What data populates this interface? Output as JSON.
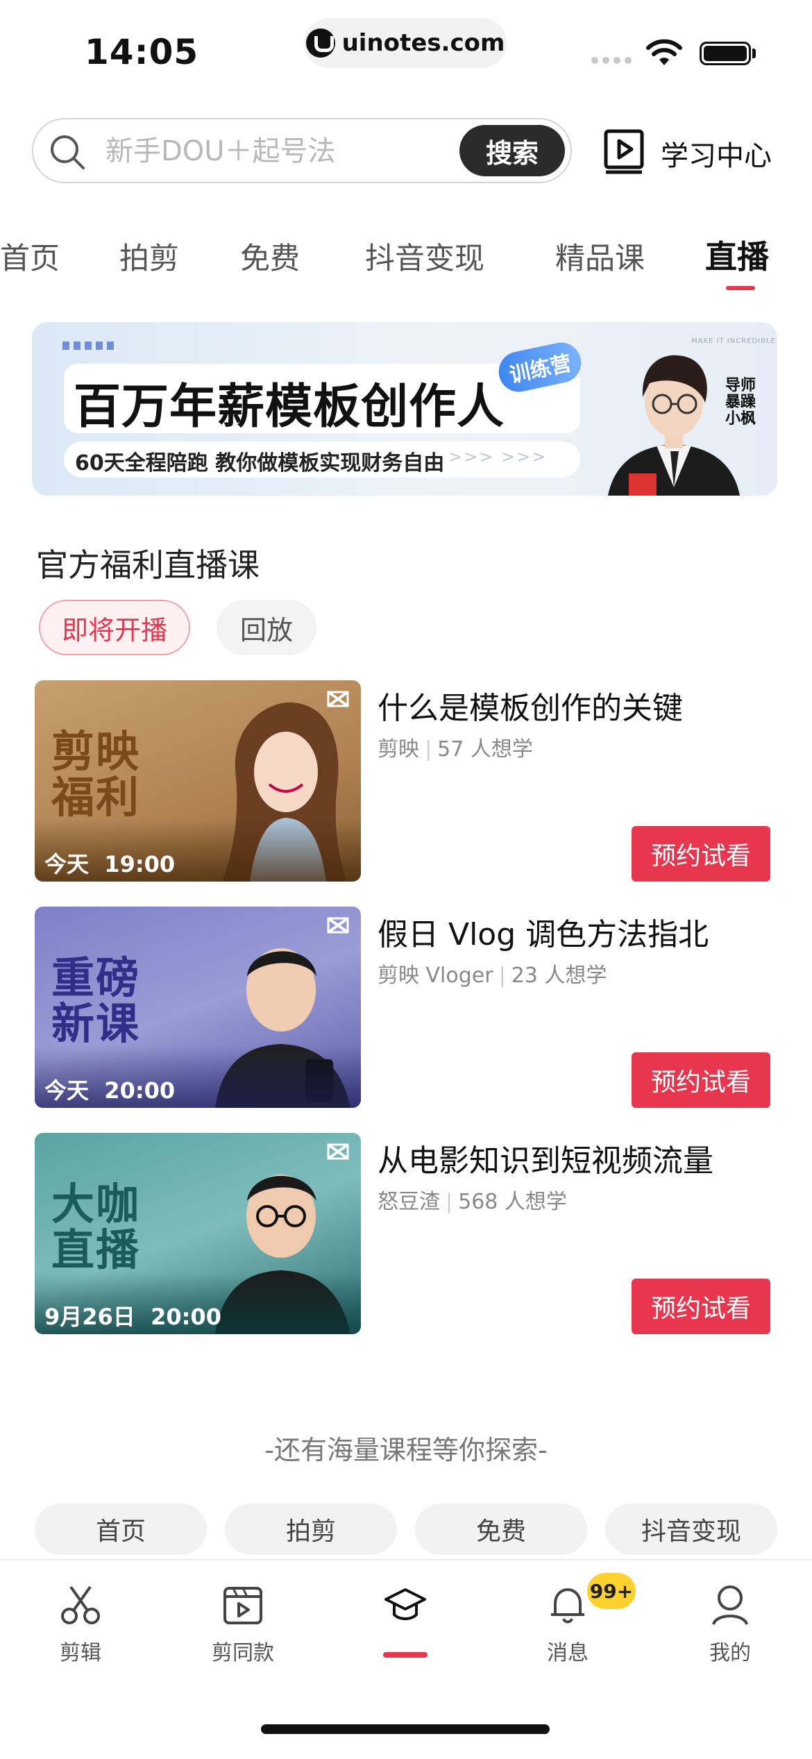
{
  "status_bar": {
    "time": "14:05",
    "url": "uinotes.com"
  },
  "search": {
    "placeholder": "新手DOU＋起号法",
    "button_label": "搜索"
  },
  "learning_center": {
    "label": "学习中心",
    "icon": "play-book-icon"
  },
  "category_tabs": [
    {
      "label": "首页",
      "active": false
    },
    {
      "label": "拍剪",
      "active": false
    },
    {
      "label": "免费",
      "active": false
    },
    {
      "label": "抖音变现",
      "active": false
    },
    {
      "label": "精品课",
      "active": false
    },
    {
      "label": "直播",
      "active": true
    }
  ],
  "banner": {
    "title": "百万年薪模板创作人",
    "subtitle": "60天全程陪跑 教你做模板实现财务自由",
    "arrows": ">>>    >>>",
    "badge": "训练营",
    "mentor": "导师暴躁小枫",
    "tiny_text": "MAKE IT INCREDIBLE"
  },
  "section": {
    "title": "官方福利直播课",
    "filters": [
      {
        "label": "即将开播",
        "active": true
      },
      {
        "label": "回放",
        "active": false
      }
    ]
  },
  "courses": [
    {
      "title": "什么是模板创作的关键",
      "author": "剪映",
      "interest": "57 人想学",
      "thumb_text": "剪映福利",
      "thumb_line1": "剪映",
      "thumb_line2": "福利",
      "thumb_date": "今天",
      "thumb_time": "19:00",
      "button_label": "预约试看",
      "thumb_color": "#b88a5a"
    },
    {
      "title": "假日 Vlog 调色方法指北",
      "author": "剪映 Vloger",
      "interest": "23 人想学",
      "thumb_text": "重磅新课",
      "thumb_line1": "重磅",
      "thumb_line2": "新课",
      "thumb_date": "今天",
      "thumb_time": "20:00",
      "button_label": "预约试看",
      "thumb_color": "#6d6fb8"
    },
    {
      "title": "从电影知识到短视频流量",
      "author": "怒豆渣",
      "interest": "568 人想学",
      "thumb_text": "大咖直播",
      "thumb_line1": "大咖",
      "thumb_line2": "直播",
      "thumb_date": "9月26日",
      "thumb_time": "20:00",
      "button_label": "预约试看",
      "thumb_color": "#3f8a8f"
    }
  ],
  "explore": {
    "text": "-还有海量课程等你探索-",
    "chips": [
      "首页",
      "拍剪",
      "免费",
      "抖音变现"
    ]
  },
  "bottom_nav": [
    {
      "label": "剪辑",
      "icon": "scissors-icon"
    },
    {
      "label": "剪同款",
      "icon": "clapperboard-icon"
    },
    {
      "label": "",
      "icon": "graduation-cap-icon",
      "active": true
    },
    {
      "label": "消息",
      "icon": "bell-icon",
      "badge": "99+"
    },
    {
      "label": "我的",
      "icon": "person-icon"
    }
  ],
  "colors": {
    "accent": "#e8364f",
    "badge": "#ffd12e",
    "dark_button": "#2b2b2b"
  }
}
